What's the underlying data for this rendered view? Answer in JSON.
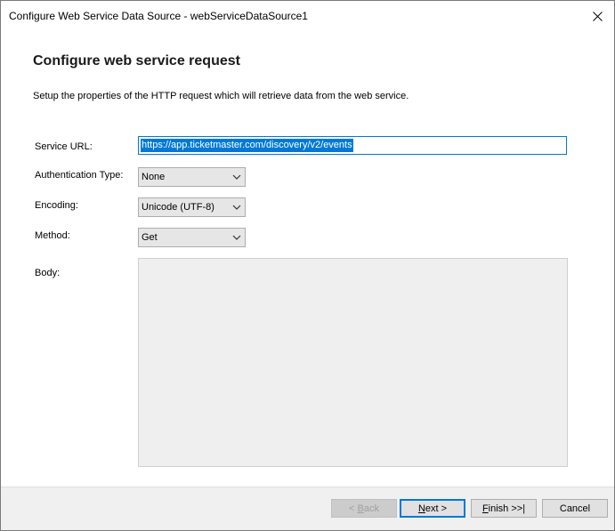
{
  "window": {
    "title": "Configure Web Service Data Source - webServiceDataSource1"
  },
  "page": {
    "heading": "Configure web service request",
    "description": "Setup the properties of the HTTP request which will retrieve data from the web service."
  },
  "form": {
    "service_url": {
      "label": "Service URL:",
      "value": "https://app.ticketmaster.com/discovery/v2/events"
    },
    "authentication_type": {
      "label": "Authentication Type:",
      "value": "None"
    },
    "encoding": {
      "label": "Encoding:",
      "value": "Unicode (UTF-8)"
    },
    "method": {
      "label": "Method:",
      "value": "Get"
    },
    "body": {
      "label": "Body:",
      "value": ""
    }
  },
  "buttons": {
    "back": {
      "prefix": "< ",
      "mnemonic": "B",
      "rest": "ack",
      "enabled": false
    },
    "next": {
      "mnemonic": "N",
      "rest": "ext >",
      "enabled": true
    },
    "finish": {
      "mnemonic": "F",
      "rest": "inish >>|",
      "enabled": true
    },
    "cancel": {
      "label": "Cancel",
      "enabled": true
    }
  },
  "icons": {
    "close": "close-icon",
    "dropdown": "chevron-down-icon"
  },
  "colors": {
    "accent": "#0078d7",
    "footer_bg": "#f0f0f0",
    "combo_bg": "#e6e6e6",
    "disabled_text": "#a0a0a0"
  }
}
